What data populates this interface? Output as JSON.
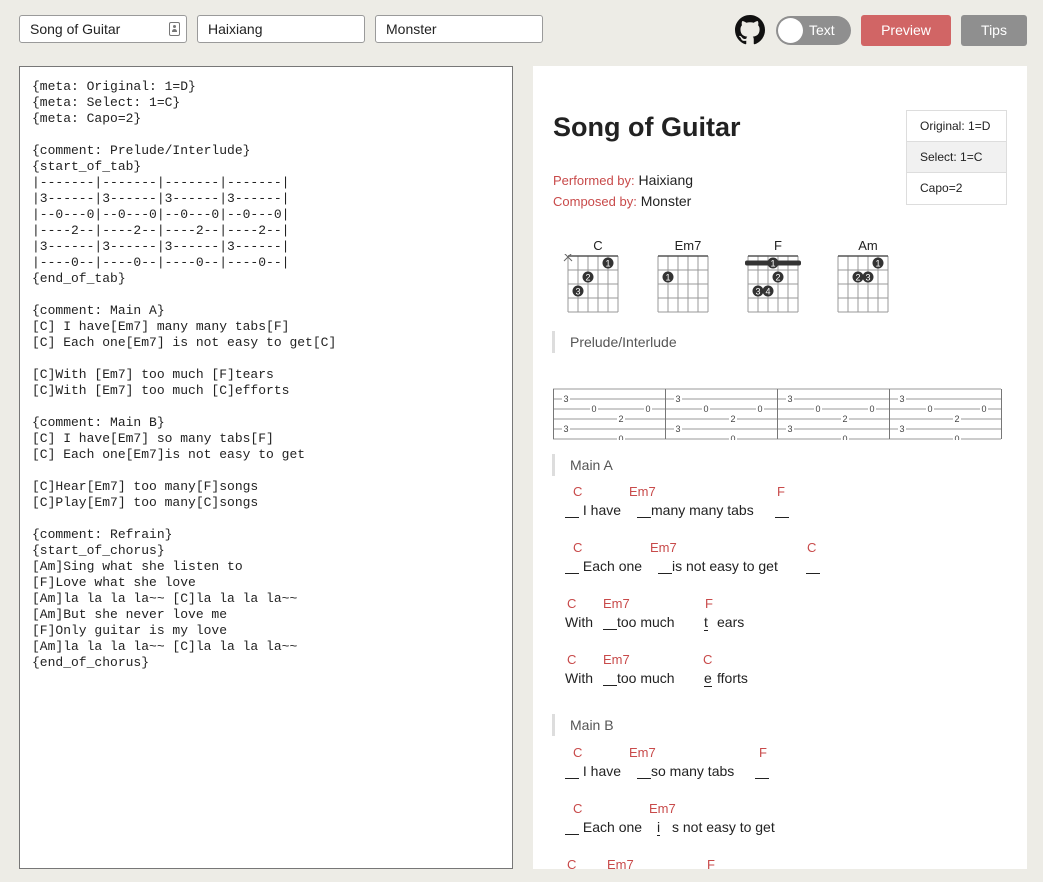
{
  "header": {
    "title_value": "Song of Guitar",
    "performer_value": "Haixiang",
    "composer_value": "Monster",
    "toggle_label": "Text",
    "preview_label": "Preview",
    "tips_label": "Tips"
  },
  "editor": {
    "lines": [
      "{meta: Original: 1=D}",
      "{meta: Select: 1=C}",
      "{meta: Capo=2}",
      "",
      "{comment: Prelude/Interlude}",
      "{start_of_tab}",
      "|-------|-------|-------|-------|",
      "|3------|3------|3------|3------|",
      "|--0---0|--0---0|--0---0|--0---0|",
      "|----2--|----2--|----2--|----2--|",
      "|3------|3------|3------|3------|",
      "|----0--|----0--|----0--|----0--|",
      "{end_of_tab}",
      "",
      "{comment: Main A}",
      "[C] I have[Em7] many many tabs[F]",
      "[C] Each one[Em7] is not easy to get[C]",
      "",
      "[C]With [Em7] too much [F]tears",
      "[C]With [Em7] too much [C]efforts",
      "",
      "{comment: Main B}",
      "[C] I have[Em7] so many tabs[F]",
      "[C] Each one[Em7]is not easy to get",
      "",
      "[C]Hear[Em7] too many[F]songs",
      "[C]Play[Em7] too many[C]songs",
      "",
      "{comment: Refrain}",
      "{start_of_chorus}",
      "[Am]Sing what she listen to",
      "[F]Love what she love",
      "[Am]la la la la~~ [C]la la la la~~",
      "[Am]But she never love me",
      "[F]Only guitar is my love",
      "[Am]la la la la~~ [C]la la la la~~",
      "{end_of_chorus}"
    ]
  },
  "preview": {
    "title": "Song of Guitar",
    "meta": [
      "Original: 1=D",
      "Select: 1=C",
      "Capo=2"
    ],
    "performed_label": "Performed by:",
    "performed_value": "Haixiang",
    "composed_label": "Composed by:",
    "composed_value": "Monster",
    "chord_diagrams": [
      {
        "name": "C",
        "muted": [
          6
        ],
        "dots": [
          {
            "string": 2,
            "fret": 1,
            "finger": "1"
          },
          {
            "string": 4,
            "fret": 2,
            "finger": "2"
          },
          {
            "string": 5,
            "fret": 3,
            "finger": "3"
          }
        ],
        "barre": null
      },
      {
        "name": "Em7",
        "muted": [],
        "dots": [
          {
            "string": 5,
            "fret": 2,
            "finger": "1"
          }
        ],
        "barre": null
      },
      {
        "name": "F",
        "muted": [],
        "dots": [
          {
            "string": 3,
            "fret": 2,
            "finger": "2"
          },
          {
            "string": 5,
            "fret": 3,
            "finger": "3"
          },
          {
            "string": 4,
            "fret": 3,
            "finger": "4"
          }
        ],
        "barre": {
          "fret": 1,
          "finger": "1"
        }
      },
      {
        "name": "Am",
        "muted": [],
        "dots": [
          {
            "string": 2,
            "fret": 1,
            "finger": "1"
          },
          {
            "string": 4,
            "fret": 2,
            "finger": "2"
          },
          {
            "string": 3,
            "fret": 2,
            "finger": "3"
          }
        ],
        "barre": null
      }
    ],
    "sections": {
      "prelude": "Prelude/Interlude",
      "main_a": "Main A",
      "main_b": "Main B"
    },
    "tab": {
      "measures": 4,
      "notes": [
        {
          "string": 2,
          "pos": 0,
          "fret": "3"
        },
        {
          "string": 3,
          "pos": 1,
          "fret": "0"
        },
        {
          "string": 4,
          "pos": 2,
          "fret": "2"
        },
        {
          "string": 3,
          "pos": 3,
          "fret": "0"
        },
        {
          "string": 5,
          "pos": 0,
          "fret": "3"
        },
        {
          "string": 6,
          "pos": 2,
          "fret": "0"
        }
      ]
    },
    "lyric_lines": [
      {
        "segments": [
          {
            "chord": "C",
            "text": " I have ",
            "blank": true
          },
          {
            "chord": "Em7",
            "text": "many many tabs ",
            "blank": true
          },
          {
            "chord": "F",
            "text": "",
            "blank": true
          }
        ]
      },
      {
        "segments": [
          {
            "chord": "C",
            "text": " Each one ",
            "blank": true
          },
          {
            "chord": "Em7",
            "text": "is not easy to get ",
            "blank": true
          },
          {
            "chord": "C",
            "text": "",
            "blank": true
          }
        ]
      },
      {
        "segments": [
          {
            "chord": "C",
            "text": "With ",
            "blank": false
          },
          {
            "chord": "Em7",
            "text": "too much ",
            "blank": true
          },
          {
            "chord": "F",
            "text": "t",
            "blank": false
          },
          {
            "chord": "",
            "text": "ears",
            "blank": false
          }
        ]
      },
      {
        "segments": [
          {
            "chord": "C",
            "text": "With ",
            "blank": false
          },
          {
            "chord": "Em7",
            "text": "too much ",
            "blank": true
          },
          {
            "chord": "C",
            "text": "e",
            "blank": false
          },
          {
            "chord": "",
            "text": "fforts",
            "blank": false
          }
        ]
      },
      {
        "segments": [
          {
            "chord": "C",
            "text": " I have ",
            "blank": true
          },
          {
            "chord": "Em7",
            "text": "so many tabs ",
            "blank": true
          },
          {
            "chord": "F",
            "text": "",
            "blank": true
          }
        ]
      },
      {
        "segments": [
          {
            "chord": "C",
            "text": " Each one ",
            "blank": true
          },
          {
            "chord": "Em7",
            "text": "i",
            "blank": false
          },
          {
            "chord": "",
            "text": "s not easy to get",
            "blank": false
          }
        ]
      },
      {
        "segments": [
          {
            "chord": "C",
            "text": "",
            "blank": false
          },
          {
            "chord": "Em7",
            "text": "",
            "blank": false
          },
          {
            "chord": "F",
            "text": "",
            "blank": false
          }
        ]
      }
    ],
    "colors": {
      "chord": "#c84a4a",
      "preview_button": "#d16565",
      "tips_button": "#8f8f8f"
    }
  }
}
